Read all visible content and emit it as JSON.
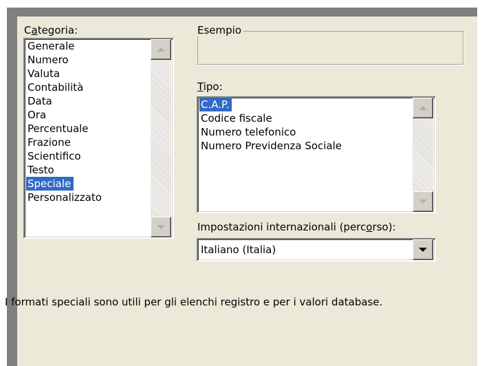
{
  "dialog": {
    "category_label": {
      "pre": "C",
      "acc": "a",
      "post": "tegoria:"
    },
    "example_label": "Esempio",
    "type_label": {
      "acc": "T",
      "post": "ipo:"
    },
    "locale_label": {
      "pre": "Impostazioni internazionali (perc",
      "acc": "o",
      "post": "rso):"
    },
    "locale_value": "Italiano (Italia)",
    "description": "I formati speciali sono utili per gli elenchi registro e per i valori database.",
    "categories": [
      {
        "label": "Generale",
        "selected": false
      },
      {
        "label": "Numero",
        "selected": false
      },
      {
        "label": "Valuta",
        "selected": false
      },
      {
        "label": "Contabilità",
        "selected": false
      },
      {
        "label": "Data",
        "selected": false
      },
      {
        "label": "Ora",
        "selected": false
      },
      {
        "label": "Percentuale",
        "selected": false
      },
      {
        "label": "Frazione",
        "selected": false
      },
      {
        "label": "Scientifico",
        "selected": false
      },
      {
        "label": "Testo",
        "selected": false
      },
      {
        "label": "Speciale",
        "selected": true
      },
      {
        "label": "Personalizzato",
        "selected": false
      }
    ],
    "types": [
      {
        "label": "C.A.P.",
        "selected": true
      },
      {
        "label": "Codice fiscale",
        "selected": false
      },
      {
        "label": "Numero telefonico",
        "selected": false
      },
      {
        "label": "Numero Previdenza  Sociale",
        "selected": false
      }
    ]
  },
  "icons": {
    "scroll_up": "triangle-up-icon",
    "scroll_down": "triangle-down-icon",
    "dropdown": "chevron-down-icon"
  },
  "colors": {
    "dialog_bg": "#ece9d8",
    "selection": "#316ac5",
    "frame": "#808080"
  }
}
